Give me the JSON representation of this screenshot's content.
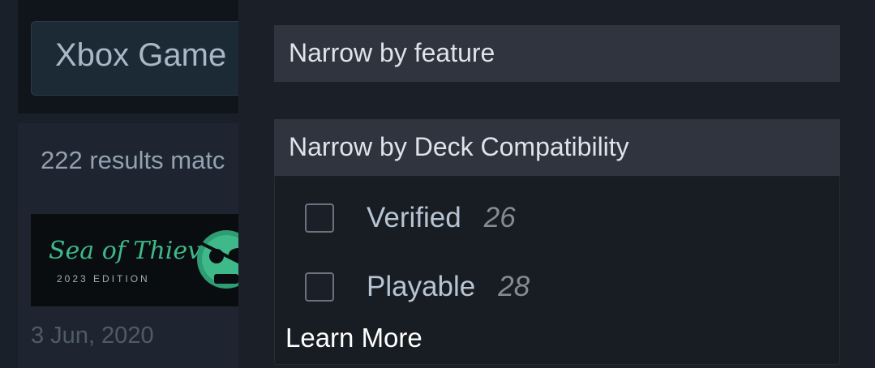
{
  "search": {
    "query": "Xbox Game"
  },
  "results": {
    "count_text": "222 results matc"
  },
  "game": {
    "logo_text": "Sea of Thieves",
    "edition_text": "2023 EDITION",
    "release_date": "3 Jun, 2020"
  },
  "filters": {
    "feature_header": "Narrow by feature",
    "deck_header": "Narrow by Deck Compatibility",
    "options": [
      {
        "label": "Verified",
        "count": "26",
        "checked": false
      },
      {
        "label": "Playable",
        "count": "28",
        "checked": false
      }
    ],
    "learn_more": "Learn More"
  },
  "colors": {
    "background": "#1b2029",
    "header_bg": "#2f343e",
    "label_color": "#b7c5d3",
    "count_color": "#848b93",
    "logo_green": "#3fb98a"
  },
  "icons": [
    "skull-logo-icon"
  ]
}
